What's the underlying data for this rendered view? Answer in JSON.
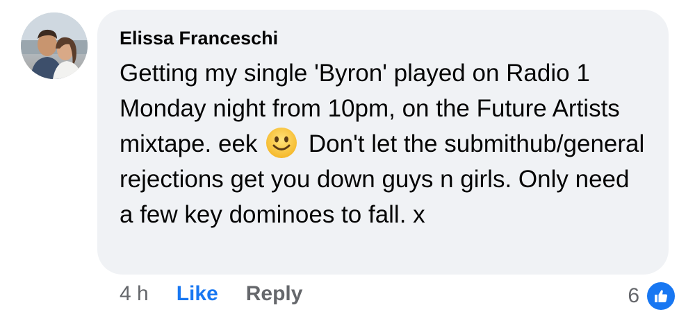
{
  "comment": {
    "author": "Elissa Franceschi",
    "text_part1": "Getting my single 'Byron' played on Radio 1 Monday night from 10pm, on the Future Artists mixtape. eek",
    "emoji": "slightly-smiling-face",
    "text_part2": "Don't let the submithub/general rejections get you down guys n girls. Only need a few key dominoes to fall. x"
  },
  "actions": {
    "time": "4 h",
    "like_label": "Like",
    "reply_label": "Reply"
  },
  "reactions": {
    "count": "6",
    "icon": "like-thumbs-up-icon"
  },
  "colors": {
    "bubble": "#f0f2f5",
    "link_blue": "#1877f2",
    "secondary_text": "#65676b"
  }
}
